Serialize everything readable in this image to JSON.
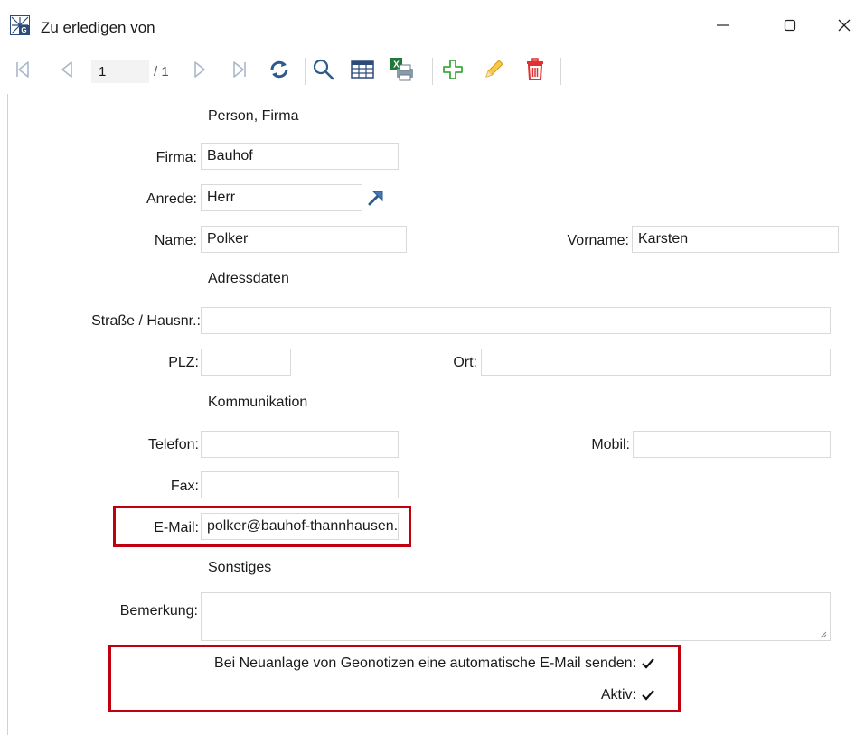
{
  "window": {
    "title": "Zu erledigen von",
    "controls": {
      "minimize": "—",
      "maximize": "",
      "close": "✕"
    }
  },
  "toolbar": {
    "page_value": "1",
    "page_total": "/ 1",
    "icons": [
      "first-page-icon",
      "prev-page-icon",
      "next-page-icon",
      "last-page-icon",
      "refresh-icon",
      "search-icon",
      "table-icon",
      "excel-export-icon",
      "add-icon",
      "edit-icon",
      "delete-icon"
    ],
    "colors": {
      "add": "#3cab3c",
      "edit": "#f0b020",
      "delete": "#e03030",
      "refresh": "#2c5a8c"
    }
  },
  "form": {
    "sections": {
      "person": "Person, Firma",
      "address": "Adressdaten",
      "communication": "Kommunikation",
      "other": "Sonstiges"
    },
    "labels": {
      "firma": "Firma:",
      "anrede": "Anrede:",
      "name": "Name:",
      "vorname": "Vorname:",
      "strasse": "Straße / Hausnr.:",
      "plz": "PLZ:",
      "ort": "Ort:",
      "telefon": "Telefon:",
      "mobil": "Mobil:",
      "fax": "Fax:",
      "email": "E-Mail:",
      "bemerkung": "Bemerkung:",
      "auto_email": "Bei Neuanlage von Geonotizen eine automatische E-Mail senden:",
      "aktiv": "Aktiv:"
    },
    "values": {
      "firma": "Bauhof",
      "anrede": "Herr",
      "name": "Polker",
      "vorname": "Karsten",
      "strasse": "",
      "plz": "",
      "ort": "",
      "telefon": "",
      "mobil": "",
      "fax": "",
      "email": "polker@bauhof-thannhausen.de",
      "bemerkung": ""
    },
    "checkboxes": {
      "auto_email": true,
      "aktiv": true
    },
    "highlight_color": "#c0000f"
  }
}
